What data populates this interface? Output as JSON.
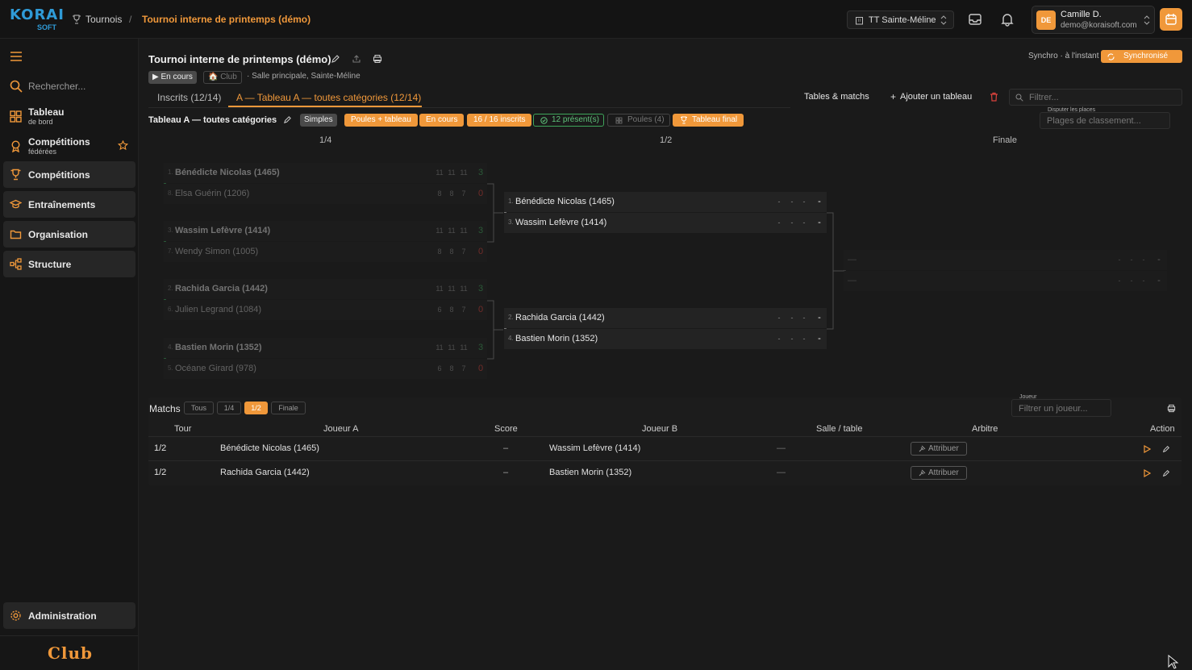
{
  "topbar": {
    "logo_main": "KORAI",
    "logo_sub": "SOFT",
    "breadcrumb_root": "Tournois",
    "breadcrumb_sep": "/",
    "breadcrumb_current": "Tournoi interne de printemps (démo)",
    "club_select": "TT Sainte-Méline",
    "user_initials": "DE",
    "user_name": "Camille D.",
    "user_email": "demo@koraisoft.com"
  },
  "sidebar": {
    "search_placeholder": "Rechercher...",
    "items": [
      {
        "label": "Tableau",
        "sub": "de bord",
        "icon": "dashboard-icon"
      },
      {
        "label": "Compétitions",
        "sub": "fédérées",
        "icon": "medal-icon"
      },
      {
        "label": "Compétitions",
        "icon": "trophy-icon"
      },
      {
        "label": "Entraînements",
        "icon": "graduation-icon"
      },
      {
        "label": "Organisation",
        "icon": "folder-icon"
      },
      {
        "label": "Structure",
        "icon": "hierarchy-icon"
      }
    ],
    "admin_label": "Administration",
    "footer_word": "Club"
  },
  "header": {
    "title": "Tournoi interne de printemps (démo)",
    "status_badge": "▶ En cours",
    "club_badge": "🏠 Club",
    "location": "· Salle principale, Sainte-Méline",
    "sync_label": "Synchro · à l'instant",
    "sync_button": "Synchronisé"
  },
  "tabs": {
    "registered": "Inscrits (12/14)",
    "draw": "A — Tableau A — toutes catégories (12/14)"
  },
  "actions": {
    "tables_matches": "Tables & matchs",
    "add_table": "Ajouter un tableau",
    "filter_placeholder": "Filtrer..."
  },
  "draw": {
    "name": "Tableau A — toutes catégories",
    "badges": [
      "Simples",
      "Poules + tableau",
      "En cours",
      "16 / 16 inscrits",
      "12 présent(s)",
      "Poules (4)",
      "Tableau final"
    ],
    "places_label": "Disputer les places",
    "places_placeholder": "Plages de classement...",
    "rounds": [
      "1/4",
      "1/2",
      "Finale"
    ]
  },
  "bracket": {
    "quarters": [
      {
        "p1": {
          "seed": "1.",
          "name": "Bénédicte Nicolas (1465)",
          "scores": [
            "11",
            "11",
            "11"
          ],
          "total": "3"
        },
        "p2": {
          "seed": "8.",
          "name": "Elsa Guérin (1206)",
          "scores": [
            "8",
            "8",
            "7"
          ],
          "total": "0"
        }
      },
      {
        "p1": {
          "seed": "3.",
          "name": "Wassim Lefèvre (1414)",
          "scores": [
            "11",
            "11",
            "11"
          ],
          "total": "3"
        },
        "p2": {
          "seed": "7.",
          "name": "Wendy Simon (1005)",
          "scores": [
            "8",
            "8",
            "7"
          ],
          "total": "0"
        }
      },
      {
        "p1": {
          "seed": "2.",
          "name": "Rachida Garcia (1442)",
          "scores": [
            "11",
            "11",
            "11"
          ],
          "total": "3"
        },
        "p2": {
          "seed": "6.",
          "name": "Julien Legrand (1084)",
          "scores": [
            "6",
            "8",
            "7"
          ],
          "total": "0"
        }
      },
      {
        "p1": {
          "seed": "4.",
          "name": "Bastien Morin (1352)",
          "scores": [
            "11",
            "11",
            "11"
          ],
          "total": "3"
        },
        "p2": {
          "seed": "5.",
          "name": "Océane Girard (978)",
          "scores": [
            "6",
            "8",
            "7"
          ],
          "total": "0"
        }
      }
    ],
    "semis": [
      {
        "p1": {
          "seed": "1.",
          "name": "Bénédicte Nicolas (1465)",
          "scores": [
            "-",
            "-",
            "-"
          ],
          "total": "-"
        },
        "p2": {
          "seed": "3.",
          "name": "Wassim Lefèvre (1414)",
          "scores": [
            "-",
            "-",
            "-"
          ],
          "total": "-"
        }
      },
      {
        "p1": {
          "seed": "2.",
          "name": "Rachida Garcia (1442)",
          "scores": [
            "-",
            "-",
            "-"
          ],
          "total": "-"
        },
        "p2": {
          "seed": "4.",
          "name": "Bastien Morin (1352)",
          "scores": [
            "-",
            "-",
            "-"
          ],
          "total": "-"
        }
      }
    ],
    "final": {
      "p1": {
        "name": "—",
        "scores": [
          "-",
          "-",
          "-"
        ],
        "total": "-"
      },
      "p2": {
        "name": "—",
        "scores": [
          "-",
          "-",
          "-"
        ],
        "total": "-"
      }
    }
  },
  "matches": {
    "title": "Matchs",
    "filters": [
      "Tous",
      "1/4",
      "1/2",
      "Finale"
    ],
    "active_filter": "1/2",
    "player_label": "Joueur",
    "player_placeholder": "Filtrer un joueur...",
    "columns": [
      "Tour",
      "Joueur A",
      "Score",
      "Joueur B",
      "Salle / table",
      "Arbitre",
      "Action"
    ],
    "rows": [
      {
        "round": "1/2",
        "a": "Bénédicte Nicolas (1465)",
        "score": "–",
        "b": "Wassim Lefèvre (1414)",
        "table": "—",
        "referee": "Attribuer"
      },
      {
        "round": "1/2",
        "a": "Rachida Garcia (1442)",
        "score": "–",
        "b": "Bastien Morin (1352)",
        "table": "—",
        "referee": "Attribuer"
      }
    ]
  },
  "colors": {
    "accent": "#f0983a",
    "green": "#3fa55a",
    "brand_blue": "#2f9bd7"
  }
}
